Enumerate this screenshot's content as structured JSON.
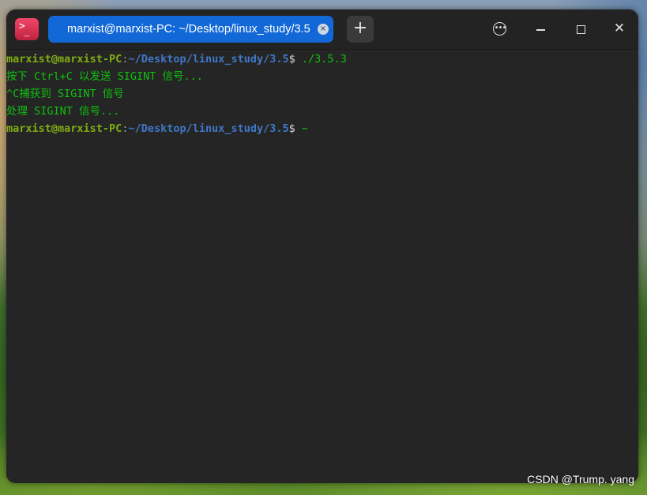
{
  "titlebar": {
    "app_icon_glyph": ">_",
    "tab_title": "marxist@marxist-PC: ~/Desktop/linux_study/3.5",
    "tab_close_glyph": "×",
    "new_tab_glyph": "+",
    "menu_glyph": "•••",
    "close_glyph": "✕"
  },
  "terminal": {
    "lines": [
      {
        "type": "prompt",
        "user": "marxist@marxist-PC",
        "colon": ":",
        "path": "~/Desktop/linux_study/3.5",
        "symbol": "$ ",
        "command": "./3.5.3"
      },
      {
        "type": "output",
        "text": "按下 Ctrl+C 以发送 SIGINT 信号..."
      },
      {
        "type": "output",
        "text": "^C捕获到 SIGINT 信号"
      },
      {
        "type": "output",
        "text": "处理 SIGINT 信号..."
      },
      {
        "type": "prompt",
        "user": "marxist@marxist-PC",
        "colon": ":",
        "path": "~/Desktop/linux_study/3.5",
        "symbol": "$ ",
        "command": "~"
      }
    ]
  },
  "watermark": "CSDN @Trump. yang",
  "colors": {
    "user": "#7fae12",
    "path": "#3e78c8",
    "output": "#10c010",
    "tab_active": "#1268d6",
    "terminal_bg": "#252525"
  },
  "icons": {
    "app": "terminal-icon",
    "tab_close": "close-icon",
    "new_tab": "plus-icon",
    "menu": "more-icon",
    "minimize": "minimize-icon",
    "maximize": "maximize-icon",
    "close": "close-icon"
  }
}
